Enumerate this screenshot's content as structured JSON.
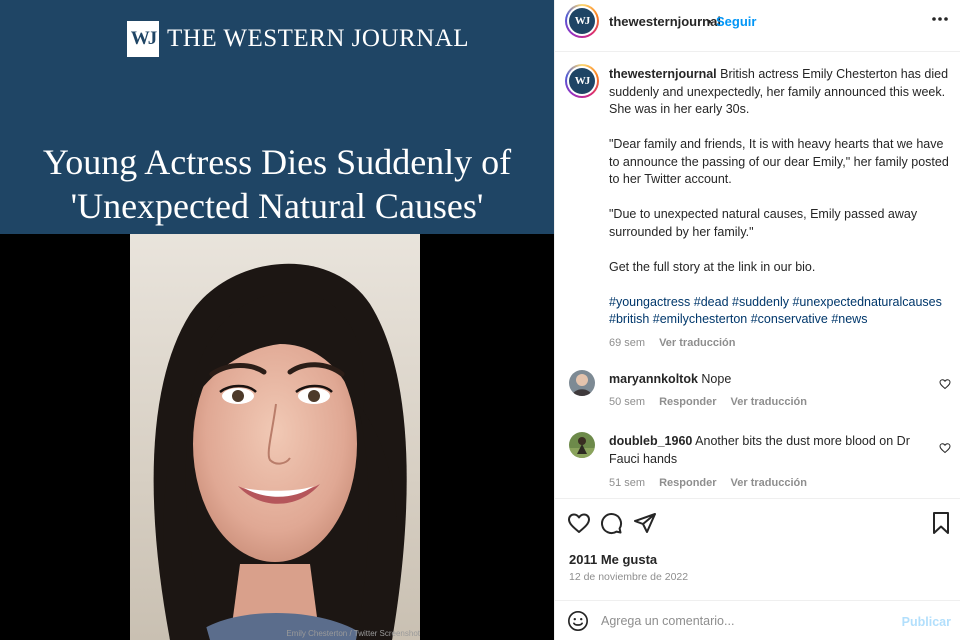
{
  "media": {
    "logo_mark": "WJ",
    "logo_text": "THE WESTERN JOURNAL",
    "headline_line1": "Young Actress Dies Suddenly of",
    "headline_line2": "'Unexpected Natural Causes'",
    "photo_credit": "Emily Chesterton / Twitter Screenshot",
    "header_color": "#1f4565"
  },
  "post_header": {
    "avatar_text": "WJ",
    "username": "thewesternjournal",
    "separator": "•",
    "follow_label": "Seguir",
    "more_icon": "more-horizontal-icon"
  },
  "caption": {
    "username": "thewesternjournal",
    "paragraph1": "British actress Emily Chesterton has died suddenly and unexpectedly, her family announced this week. She was in her early 30s.",
    "paragraph2": "\"Dear family and friends, It is with heavy hearts that we have to announce the passing of our dear Emily,\" her family posted to her Twitter account.",
    "paragraph3": "\"Due to unexpected natural causes, Emily passed away surrounded by her family.\"",
    "paragraph4": "Get the full story at the link in our bio.",
    "hashtags": "#youngactress #dead #suddenly #unexpectednaturalcauses #british #emilychesterton #conservative #news",
    "time": "69 sem",
    "translate_label": "Ver traducción"
  },
  "comments": [
    {
      "username": "maryannkoltok",
      "text": "Nope",
      "time": "50 sem",
      "reply_label": "Responder",
      "translate_label": "Ver traducción"
    },
    {
      "username": "doubleb_1960",
      "text": "Another bits the dust more blood on Dr Fauci hands",
      "time": "51 sem",
      "reply_label": "Responder",
      "translate_label": "Ver traducción"
    }
  ],
  "actions": {
    "like_icon": "heart-icon",
    "comment_icon": "comment-icon",
    "share_icon": "send-icon",
    "save_icon": "bookmark-icon"
  },
  "likes_text": "2011 Me gusta",
  "date_text": "12 de noviembre de 2022",
  "add_comment": {
    "placeholder": "Agrega un comentario...",
    "publish_label": "Publicar",
    "emoji_icon": "emoji-icon"
  },
  "colors": {
    "accent": "#0095f6",
    "hashtag": "#00376b",
    "muted": "#8e8e8e",
    "publish_disabled": "#b2dffc"
  }
}
